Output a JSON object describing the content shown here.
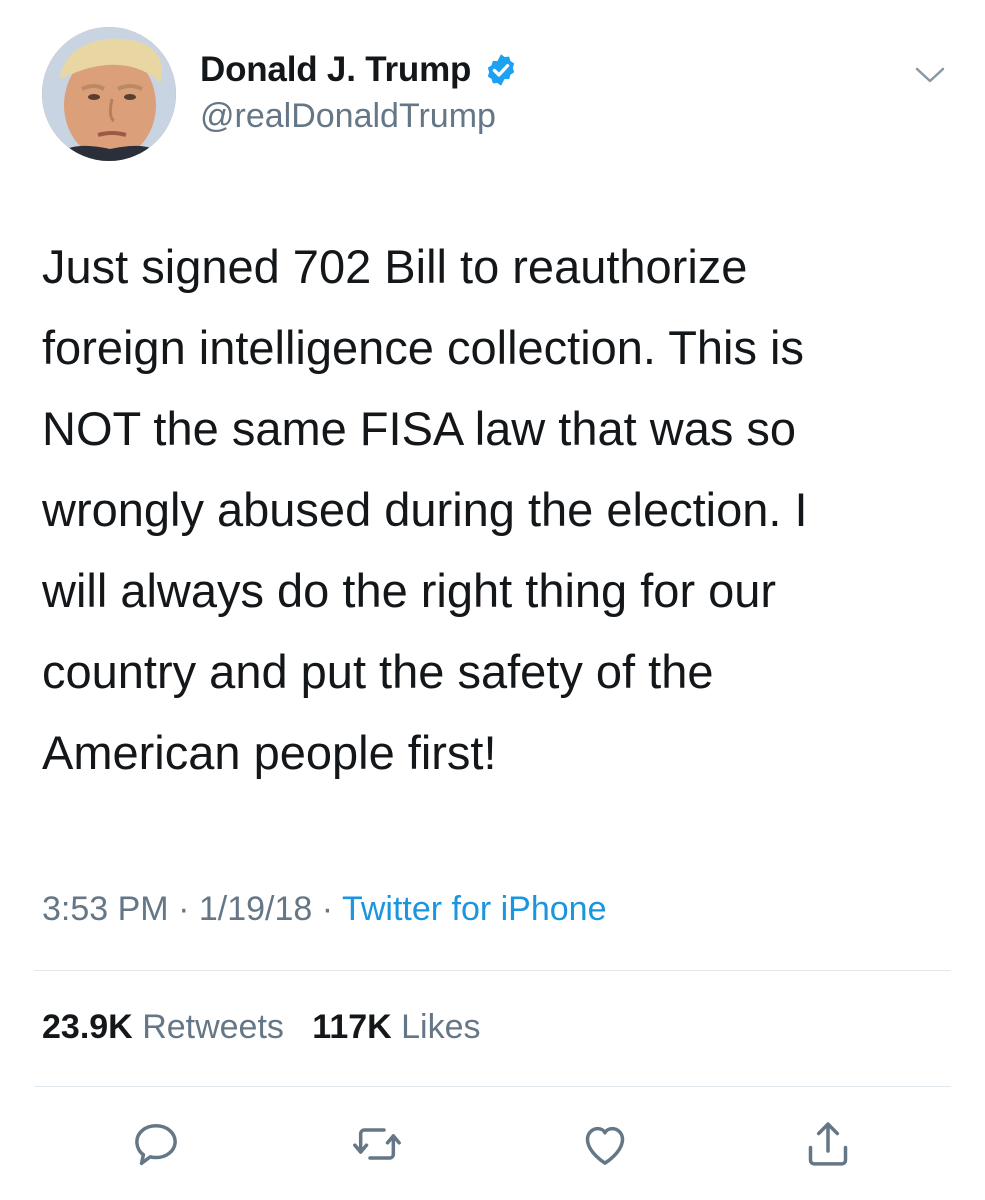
{
  "author": {
    "display_name": "Donald J. Trump",
    "handle": "@realDonaldTrump",
    "avatar_icon": "profile-photo",
    "verified_badge_icon": "verified-badge-icon"
  },
  "tweet": {
    "text": "Just signed 702 Bill to reauthorize\nforeign intelligence collection. This is\nNOT the same FISA law that was so\nwrongly abused during the election. I\nwill always do the right thing for our\ncountry and put the safety of the\nAmerican people first!",
    "time": "3:53 PM",
    "date": "1/19/18",
    "separator": "·",
    "source": "Twitter for iPhone"
  },
  "stats": {
    "retweets_count": "23.9K",
    "retweets_label": "Retweets",
    "likes_count": "117K",
    "likes_label": "Likes"
  },
  "actions": [
    "reply-icon",
    "retweet-icon",
    "like-icon",
    "share-icon"
  ],
  "colors": {
    "text": "#14171a",
    "secondary": "#657786",
    "link": "#1b95e0",
    "verified": "#1da1f2",
    "divider": "#e1e8ed"
  }
}
